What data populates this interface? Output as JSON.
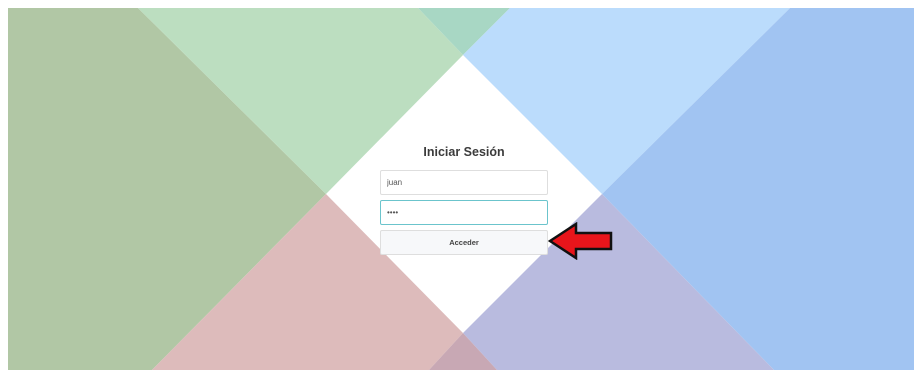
{
  "login": {
    "title": "Iniciar Sesión",
    "username_value": "juan",
    "password_value": "1234",
    "submit_label": "Acceder"
  },
  "background": {
    "colors": {
      "green_dark": "#b1c7a5",
      "green_light": "#bcdec0",
      "teal": "#a8d7c4",
      "blue_light": "#bbdcfc",
      "blue_dark": "#a1c4f2",
      "red": "#ddbbbb",
      "purple": "#b9bbdf",
      "overlap": "#c8a8b4"
    }
  },
  "annotation": {
    "icon": "red-arrow-icon",
    "color": "#e8151b",
    "outline": "#111111"
  }
}
